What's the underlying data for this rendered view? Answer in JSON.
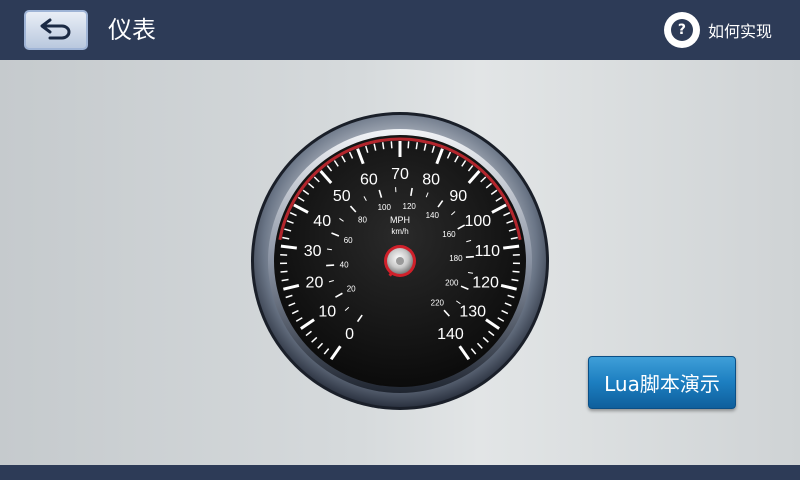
{
  "header": {
    "title": "仪表",
    "help_label": "如何实现",
    "help_glyph": "?"
  },
  "gauge": {
    "unit_mph": "MPH",
    "unit_kmh": "km/h",
    "mph_labels": [
      "0",
      "10",
      "20",
      "30",
      "40",
      "50",
      "60",
      "70",
      "80",
      "90",
      "100",
      "110",
      "120",
      "130",
      "140"
    ],
    "kmh_labels": [
      "20",
      "40",
      "60",
      "80",
      "100",
      "120",
      "140",
      "160",
      "180",
      "200",
      "220"
    ],
    "mph_min": 0,
    "mph_max": 140,
    "needle_value_mph": 0
  },
  "actions": {
    "lua_demo_label": "Lua脚本演示"
  },
  "colors": {
    "bar": "#2d3b57",
    "button_blue": "#1c7ec0",
    "needle_red": "#d0202a"
  }
}
